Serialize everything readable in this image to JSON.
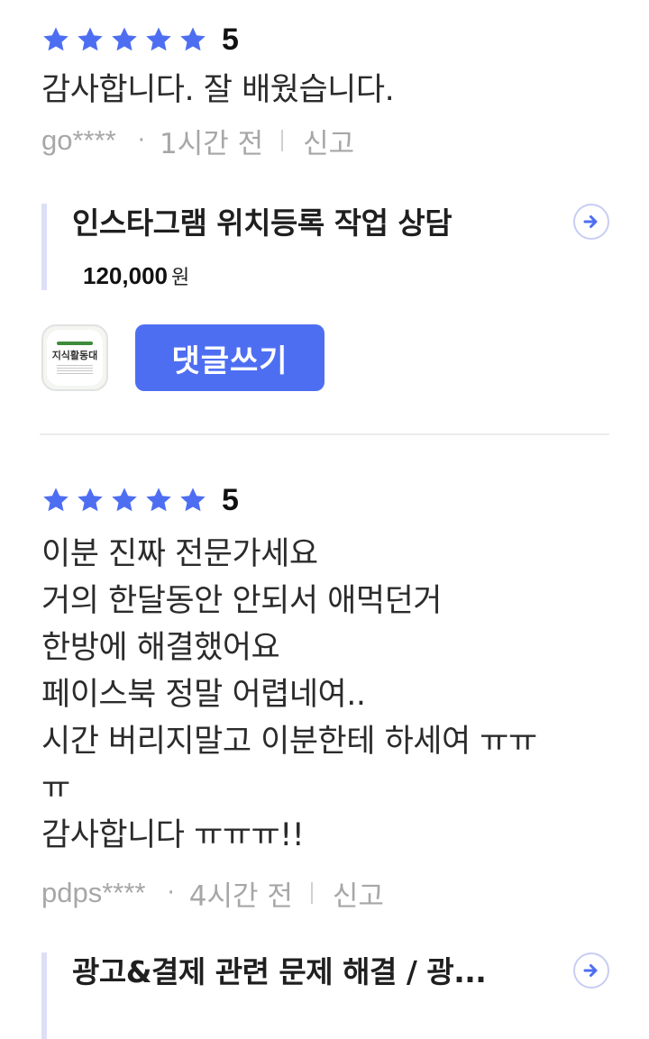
{
  "reviews": [
    {
      "rating": "5",
      "star_count": 5,
      "star_color": "#4e6ef2",
      "text_lines": [
        "감사합니다. 잘 배웠습니다."
      ],
      "user": "go****",
      "time": "1시간 전",
      "report_label": "신고",
      "product": {
        "title": "인스타그램 위치등록 작업 상담",
        "price": "120,000",
        "price_unit": "원",
        "arrow_icon": "arrow-right-circle-icon"
      },
      "avatar_label": "지식활동대",
      "comment_button": "댓글쓰기"
    },
    {
      "rating": "5",
      "star_count": 5,
      "star_color": "#4e6ef2",
      "text_lines": [
        "이분 진짜 전문가세요",
        "거의 한달동안 안되서 애먹던거",
        "한방에 해결했어요",
        "페이스북 정말 어렵네여..",
        "시간 버리지말고 이분한테 하세여 ㅠㅠ",
        "ㅠ",
        "감사합니다 ㅠㅠㅠ!!"
      ],
      "user": "pdps****",
      "time": "4시간 전",
      "report_label": "신고",
      "product": {
        "title": "광고&결제 관련 문제 해결 / 광...",
        "arrow_icon": "arrow-right-circle-icon"
      }
    }
  ],
  "colors": {
    "accent": "#4e6ef2",
    "meta_text": "#a7a7a7",
    "card_border": "#dcdff6"
  }
}
